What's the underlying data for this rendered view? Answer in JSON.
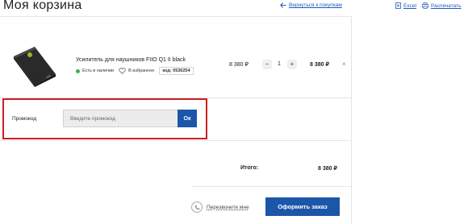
{
  "page": {
    "title": "Моя корзина"
  },
  "header_links": {
    "back": "Вернуться к покупкам",
    "excel": "Excel",
    "print": "Распечатать"
  },
  "cart_item": {
    "name": "Усилитель для наушников FIIO Q1 II black",
    "availability": "Есть в наличии",
    "favorite": "В избранное",
    "code": "код: 0536254",
    "price": "8 380 ₽",
    "quantity": "1",
    "minus": "−",
    "plus": "+",
    "total": "8 380 ₽",
    "remove": "×"
  },
  "promo": {
    "label": "Промокод",
    "placeholder": "Введите промокод",
    "button": "Ок"
  },
  "summary": {
    "total_label": "Итого:",
    "total_value": "8 380 ₽"
  },
  "actions": {
    "callback": "Перезвоните мне",
    "checkout": "Оформить заказ"
  },
  "colors": {
    "accent": "#1b56a8",
    "highlight": "#cc1f1f",
    "in_stock": "#3fae49"
  }
}
